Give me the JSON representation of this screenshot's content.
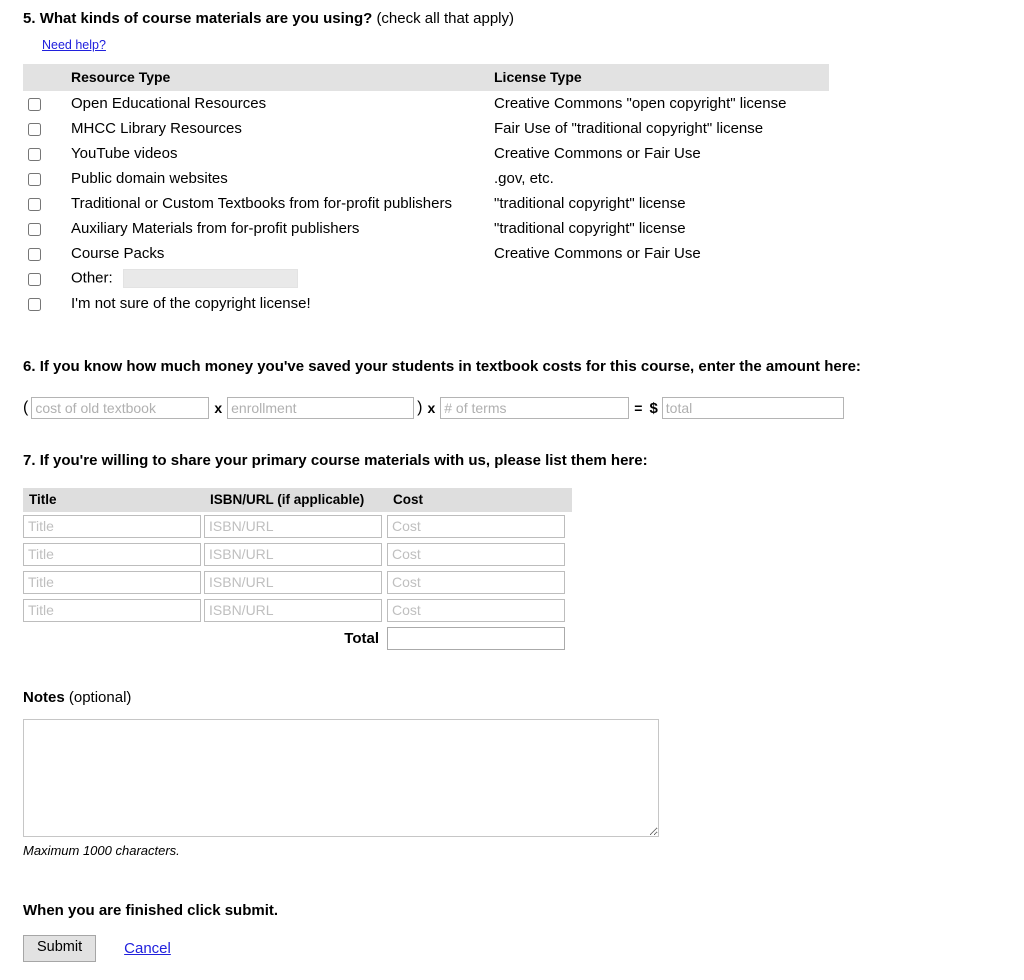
{
  "q5": {
    "number": "5.",
    "title": "What kinds of course materials are you using?",
    "subtitle": "(check all that apply)",
    "need_help_label": "Need help?",
    "columns": [
      "",
      "Resource Type",
      "License Type"
    ],
    "rows": [
      {
        "resource": "Open Educational Resources",
        "license": "Creative Commons \"open copyright\" license",
        "checked": false
      },
      {
        "resource": "MHCC Library Resources",
        "license": "Fair Use of \"traditional copyright\" license",
        "checked": false
      },
      {
        "resource": "YouTube videos",
        "license": "Creative Commons or Fair Use",
        "checked": false
      },
      {
        "resource": "Public domain websites",
        "license": ".gov, etc.",
        "checked": false
      },
      {
        "resource": "Traditional or Custom Textbooks from for-profit publishers",
        "license": "\"traditional copyright\" license",
        "checked": false
      },
      {
        "resource": "Auxiliary Materials from for-profit publishers",
        "license": "\"traditional copyright\" license",
        "checked": false
      },
      {
        "resource": "Course Packs",
        "license": "Creative Commons or Fair Use",
        "checked": false
      }
    ],
    "other_label": "Other:",
    "other_value": "",
    "not_sure_label": "I'm not sure of the copyright license!"
  },
  "q6": {
    "number": "6.",
    "title": "If you know how much money you've saved your students in textbook costs for this course, enter the amount here:",
    "open_paren": "(",
    "close_paren": ")",
    "multiply": "x",
    "equals": "=",
    "dollar": "$",
    "cost_placeholder": "cost of old textbook",
    "cost_value": "",
    "enrollment_placeholder": "enrollment",
    "enrollment_value": "",
    "terms_placeholder": "# of terms",
    "terms_value": "",
    "total_placeholder": "total",
    "total_value": ""
  },
  "q7": {
    "number": "7.",
    "title": "If you're willing to share your primary course materials with us, please list them here:",
    "columns": [
      "Title",
      "ISBN/URL (if applicable)",
      "Cost"
    ],
    "placeholders": {
      "title": "Title",
      "isbn": "ISBN/URL",
      "cost": "Cost"
    },
    "rows": [
      {
        "title": "",
        "isbn": "",
        "cost": ""
      },
      {
        "title": "",
        "isbn": "",
        "cost": ""
      },
      {
        "title": "",
        "isbn": "",
        "cost": ""
      },
      {
        "title": "",
        "isbn": "",
        "cost": ""
      }
    ],
    "total_label": "Total",
    "total_value": ""
  },
  "notes": {
    "label": "Notes",
    "optional": "(optional)",
    "value": "",
    "hint": "Maximum 1000 characters."
  },
  "footer": {
    "finish_text": "When you are finished click submit.",
    "submit_label": "Submit",
    "cancel_label": "Cancel"
  },
  "colors": {
    "link": "#2020dd",
    "header_bg": "#e2e2e2",
    "button_bg": "#e2e2e2",
    "input_border": "#b4b4b4",
    "disabled_bg": "#e9e9e9"
  }
}
